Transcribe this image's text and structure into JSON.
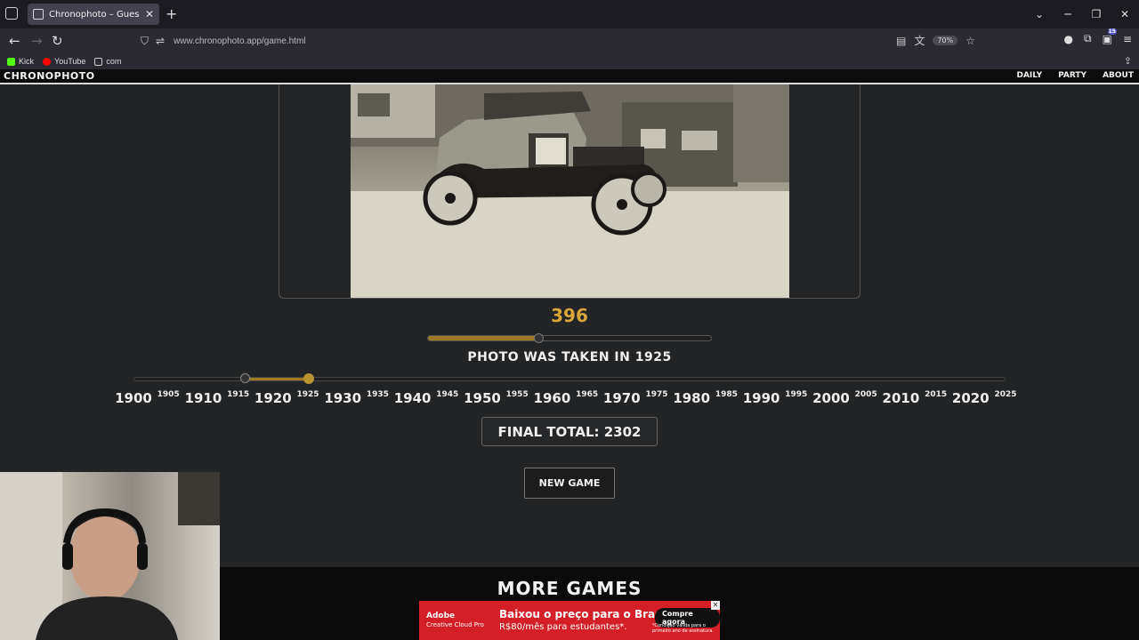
{
  "browser": {
    "tab_title": "Chronophoto – Guess the Year",
    "url": "www.chronophoto.app/game.html",
    "zoom": "70%",
    "extension_badge": "15",
    "bookmarks": [
      {
        "label": "Kick",
        "color": "#53fc18"
      },
      {
        "label": "YouTube",
        "color": "#ff0000"
      },
      {
        "label": "com",
        "color": "#cccccc"
      }
    ]
  },
  "site": {
    "logo": "CHRONOPHOTO",
    "nav": [
      "DAILY",
      "PARTY",
      "ABOUT"
    ]
  },
  "game": {
    "round_score": "396",
    "round_score_fraction": 0.39,
    "photo_year_text": "PHOTO WAS TAKEN IN 1925",
    "guess_year": 1916,
    "answer_year": 1925,
    "year_min": 1900,
    "year_max": 2025,
    "final_total": "FINAL TOTAL: 2302",
    "new_game_label": "NEW GAME",
    "accent_color": "#d7a63d"
  },
  "timeline": {
    "major": [
      "1900",
      "1910",
      "1920",
      "1930",
      "1940",
      "1950",
      "1960",
      "1970",
      "1980",
      "1990",
      "2000",
      "2010",
      "2020"
    ],
    "minor": [
      "1905",
      "1915",
      "1925",
      "1935",
      "1945",
      "1955",
      "1965",
      "1975",
      "1985",
      "1995",
      "2005",
      "2015",
      "2025"
    ]
  },
  "more_games": "MORE GAMES",
  "ad": {
    "brand": "Adobe",
    "brand_sub": "Creative Cloud Pro",
    "headline": "Baixou o preço para o Brasil.",
    "subline": "R$80/mês para estudantes*.",
    "cta": "Compre agora",
    "fine_print": "*Condição válida para o primeiro ano de assinatura."
  }
}
